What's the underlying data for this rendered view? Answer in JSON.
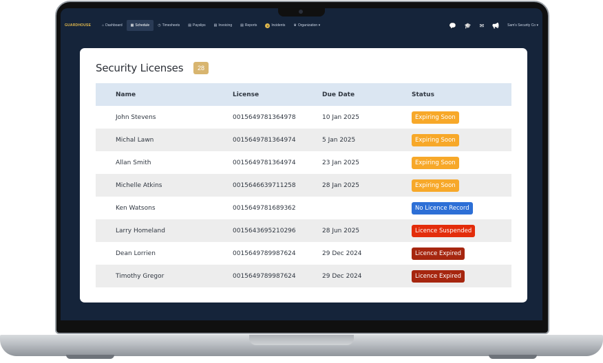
{
  "colors": {
    "nav_bg": "#15243a",
    "brand": "#e0b84c",
    "header_row": "#dbe6f2",
    "expiring_soon": "#f7a829",
    "no_record": "#2d6fd6",
    "suspended": "#e32d0b",
    "expired": "#a6260f",
    "count_badge": "#d8b56f"
  },
  "nav": {
    "brand": "GUARDHOUSE",
    "items": [
      {
        "label": "Dashboard",
        "icon": "home-icon",
        "glyph": "⌂"
      },
      {
        "label": "Schedule",
        "icon": "calendar-icon",
        "glyph": "▦",
        "active": true
      },
      {
        "label": "Timesheets",
        "icon": "clock-icon",
        "glyph": "◷"
      },
      {
        "label": "Payslips",
        "icon": "list-icon",
        "glyph": "▤"
      },
      {
        "label": "Invoicing",
        "icon": "invoice-icon",
        "glyph": "▤"
      },
      {
        "label": "Reports",
        "icon": "report-icon",
        "glyph": "▤"
      },
      {
        "label": "Incidents",
        "icon": "incident-badge-icon",
        "glyph": "8"
      },
      {
        "label": "Organization ▾",
        "icon": "organization-icon",
        "glyph": "♛"
      }
    ],
    "right_icons": [
      {
        "name": "chat-icon",
        "glyph": "💬"
      },
      {
        "name": "graduation-cap-icon",
        "glyph": "🎓"
      },
      {
        "name": "mail-icon",
        "glyph": "✉"
      },
      {
        "name": "megaphone-icon",
        "glyph": "📢"
      }
    ],
    "account": "Sam's Security Co ▾"
  },
  "card": {
    "title": "Security Licenses",
    "count": "28"
  },
  "table": {
    "headers": [
      "Name",
      "License",
      "Due Date",
      "Status"
    ],
    "rows": [
      {
        "name": "John Stevens",
        "license": "0015649781364978",
        "due": "10 Jan 2025",
        "status": "Expiring Soon",
        "kind": "expiring_soon"
      },
      {
        "name": "Michal Lawn",
        "license": "0015649781364974",
        "due": "5 Jan 2025",
        "status": "Expiring Soon",
        "kind": "expiring_soon"
      },
      {
        "name": "Allan Smith",
        "license": "0015649781364974",
        "due": "23 Jan 2025",
        "status": "Expiring Soon",
        "kind": "expiring_soon"
      },
      {
        "name": "Michelle Atkins",
        "license": "0015646639711258",
        "due": "28 Jan 2025",
        "status": "Expiring Soon",
        "kind": "expiring_soon"
      },
      {
        "name": "Ken Watsons",
        "license": "0015649781689362",
        "due": "",
        "status": "No Licence Record",
        "kind": "no_record"
      },
      {
        "name": "Larry Homeland",
        "license": "0015643695210296",
        "due": "28 Jun 2025",
        "status": "Licence Suspended",
        "kind": "suspended"
      },
      {
        "name": "Dean Lorrien",
        "license": "0015649789987624",
        "due": "29 Dec 2024",
        "status": "Licence Expired",
        "kind": "expired"
      },
      {
        "name": "Timothy Gregor",
        "license": "0015649789987624",
        "due": "29 Dec 2024",
        "status": "Licence Expired",
        "kind": "expired"
      }
    ]
  }
}
